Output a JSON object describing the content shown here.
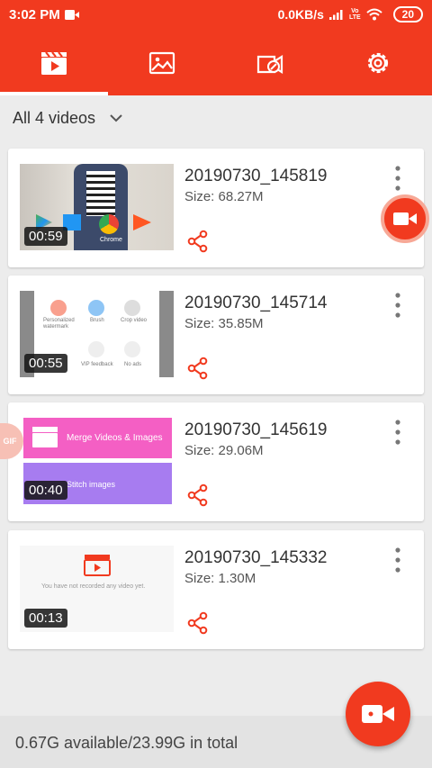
{
  "status_bar": {
    "time": "3:02 PM",
    "network_speed": "0.0KB/s",
    "volte_top": "Vo",
    "volte_bottom": "LTE",
    "battery": "20"
  },
  "tabs": [
    {
      "name": "videos",
      "icon": "video-clapper-icon",
      "selected": true
    },
    {
      "name": "images",
      "icon": "image-icon",
      "selected": false
    },
    {
      "name": "tools",
      "icon": "video-edit-icon",
      "selected": false
    },
    {
      "name": "settings",
      "icon": "gear-icon",
      "selected": false
    }
  ],
  "filter": {
    "label": "All 4 videos"
  },
  "videos": [
    {
      "title": "20190730_145819",
      "size": "Size: 68.27M",
      "duration": "00:59",
      "thumb_text": [
        "Chrome"
      ]
    },
    {
      "title": "20190730_145714",
      "size": "Size: 35.85M",
      "duration": "00:55",
      "thumb_text": [
        "Personalized watermark",
        "Brush",
        "Crop video",
        "VIP feedback",
        "No ads"
      ]
    },
    {
      "title": "20190730_145619",
      "size": "Size: 29.06M",
      "duration": "00:40",
      "thumb_text": [
        "Merge Videos & Images",
        "Stitch images"
      ]
    },
    {
      "title": "20190730_145332",
      "size": "Size: 1.30M",
      "duration": "00:13",
      "thumb_text": [
        "You have not recorded any video yet."
      ]
    }
  ],
  "floating_gif_label": "GIF",
  "storage": {
    "text": "0.67G available/23.99G in total"
  },
  "colors": {
    "accent": "#f13a1f",
    "background": "#ececec",
    "card": "#ffffff"
  }
}
